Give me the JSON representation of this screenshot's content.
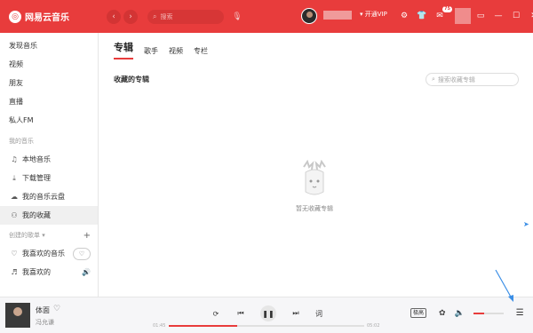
{
  "header": {
    "app_name": "网易云音乐",
    "back": "‹",
    "forward": "›",
    "search_placeholder": "搜索",
    "vip_label": "▾ 开通VIP",
    "message_count": "75"
  },
  "sidebar": {
    "items": [
      {
        "label": "发现音乐"
      },
      {
        "label": "视频"
      },
      {
        "label": "朋友"
      },
      {
        "label": "直播"
      },
      {
        "label": "私人FM"
      }
    ],
    "my_music_title": "我的音乐",
    "my_music": [
      {
        "label": "本地音乐",
        "icon": "music-note-icon"
      },
      {
        "label": "下载管理",
        "icon": "download-icon"
      },
      {
        "label": "我的音乐云盘",
        "icon": "cloud-icon"
      },
      {
        "label": "我的收藏",
        "icon": "collection-icon"
      }
    ],
    "created_title": "创建的歌单 ▾",
    "created_add": "+",
    "playlists": [
      {
        "label": "我喜欢的音乐",
        "icon": "heart-icon"
      },
      {
        "label": "我喜欢的",
        "icon": "playlist-icon"
      }
    ]
  },
  "main": {
    "tabs": [
      {
        "label": "专辑",
        "active": true
      },
      {
        "label": "歌手",
        "active": false
      },
      {
        "label": "视频",
        "active": false
      },
      {
        "label": "专栏",
        "active": false
      }
    ],
    "section_title": "收藏的专辑",
    "search_placeholder": "搜索收藏专辑",
    "empty_text": "暂无收藏专辑"
  },
  "player": {
    "song_title": "体面",
    "artist": "冯允谦",
    "time_current": "01:45",
    "time_total": "05:02",
    "progress": 0.35,
    "lyric_label": "词",
    "quality_label": "极高",
    "volume": 0.35
  },
  "colors": {
    "accent": "#e83c3c",
    "annotation": "#3a8ee6"
  }
}
